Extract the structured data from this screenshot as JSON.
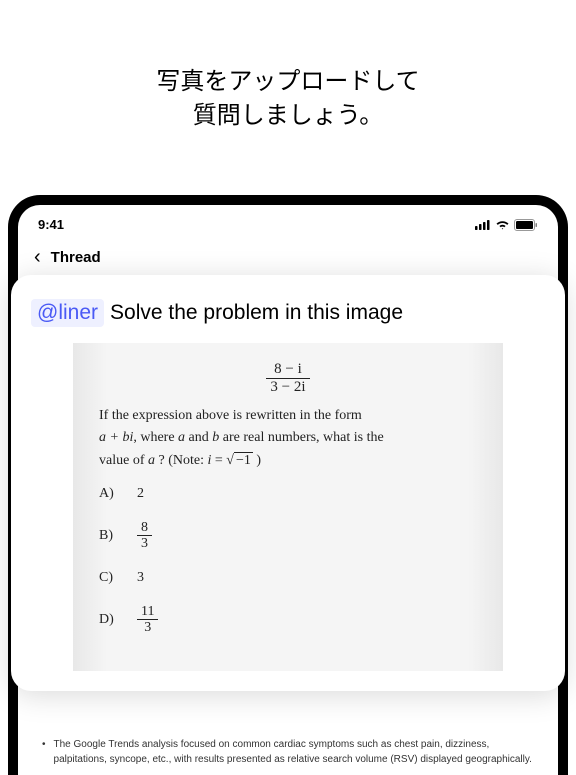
{
  "headline": {
    "line1": "写真をアップロードして",
    "line2": "質問しましょう。"
  },
  "status": {
    "time": "9:41"
  },
  "nav": {
    "title": "Thread"
  },
  "card": {
    "mention": "@liner",
    "prompt": "Solve the problem in this image"
  },
  "math": {
    "frac_num": "8 − i",
    "frac_den": "3 − 2i",
    "text_part1": "If the expression above is rewritten in the form",
    "text_part2_prefix": "a + bi",
    "text_part2_mid": ", where ",
    "text_part2_a": "a",
    "text_part2_and": " and ",
    "text_part2_b": "b",
    "text_part2_suffix": " are real numbers, what is the",
    "text_part3_prefix": "value of ",
    "text_part3_a": "a",
    "text_part3_note_prefix": " ? (Note: ",
    "text_part3_i": "i",
    "text_part3_eq": " = ",
    "text_part3_sqrt": "−1",
    "text_part3_close": " )",
    "choices": [
      {
        "label": "A)",
        "value": "2",
        "frac": false
      },
      {
        "label": "B)",
        "num": "8",
        "den": "3",
        "frac": true
      },
      {
        "label": "C)",
        "value": "3",
        "frac": false
      },
      {
        "label": "D)",
        "num": "11",
        "den": "3",
        "frac": true
      }
    ]
  },
  "bottom": {
    "bullet": "•",
    "text": "The Google Trends analysis focused on common cardiac symptoms such as chest pain, dizziness, palpitations, syncope, etc., with results presented as relative search volume (RSV) displayed geographically."
  }
}
